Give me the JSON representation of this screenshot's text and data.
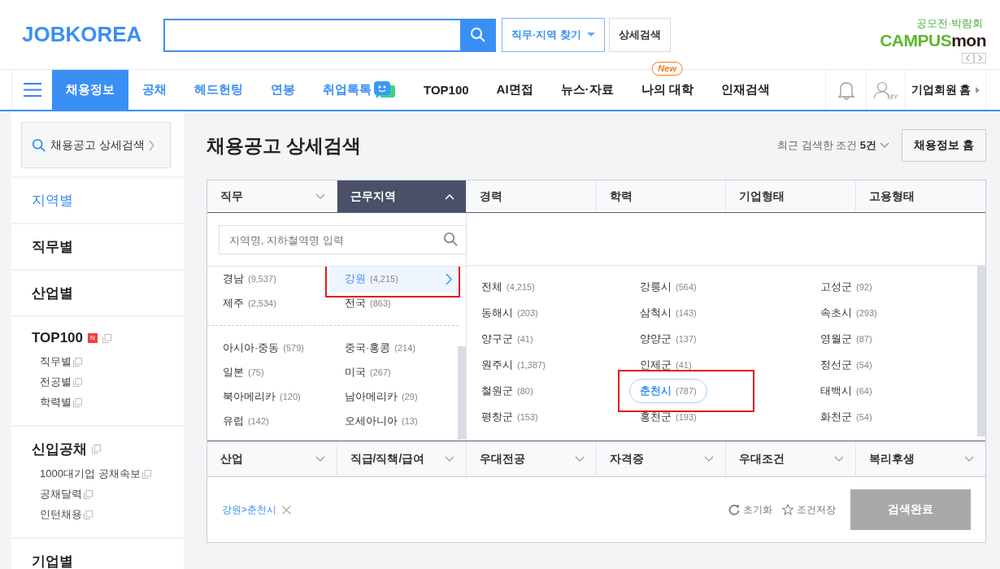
{
  "header": {
    "logo": "JOBKOREA",
    "buttons": [
      {
        "label": "직무·지역 찾기",
        "kind": "dropdown"
      },
      {
        "label": "상세검색",
        "kind": "plain"
      }
    ],
    "ad": {
      "caption": "공모전·박람회",
      "brand_a": "CAMPUS",
      "brand_b": "mon"
    }
  },
  "nav": {
    "items": [
      {
        "label": "채용정보",
        "kind": "featured",
        "selected": true
      },
      {
        "label": "공채",
        "kind": "featured",
        "selected": false
      },
      {
        "label": "헤드헌팅",
        "kind": "featured",
        "selected": false
      },
      {
        "label": "연봉",
        "kind": "featured",
        "selected": false
      },
      {
        "label": "취업톡톡",
        "kind": "featured",
        "selected": false,
        "chat_icon": true
      },
      {
        "label": "TOP100",
        "kind": "plain",
        "selected": false
      },
      {
        "label": "AI면접",
        "kind": "plain",
        "selected": false
      },
      {
        "label": "뉴스·자료",
        "kind": "plain",
        "selected": false
      },
      {
        "label": "나의 대학",
        "kind": "plain",
        "selected": false,
        "badge": "New"
      },
      {
        "label": "인재검색",
        "kind": "plain",
        "selected": false
      }
    ],
    "my_label": "MY",
    "corporate": "기업회원 홈"
  },
  "sidebar": {
    "search_button": "채용공고 상세검색",
    "items": [
      {
        "label": "지역별",
        "selected": true
      },
      {
        "label": "직무별",
        "selected": false
      },
      {
        "label": "산업별",
        "selected": false
      },
      {
        "label": "TOP100",
        "selected": false,
        "badge": "N",
        "children": [
          {
            "label": "직무별"
          },
          {
            "label": "전공별"
          },
          {
            "label": "학력별"
          }
        ]
      },
      {
        "label": "신입공채",
        "selected": false,
        "children": [
          {
            "label": "1000대기업 공채속보"
          },
          {
            "label": "공채달력"
          },
          {
            "label": "인턴채용"
          }
        ]
      },
      {
        "label": "기업별",
        "selected": false
      }
    ]
  },
  "main": {
    "title": "채용공고 상세검색",
    "recent": "최근 검색한 조건 **5건**",
    "home_button": "채용정보 홈",
    "filter_tabs": [
      {
        "label": "직무",
        "selected": false,
        "chevron": true
      },
      {
        "label": "근무지역",
        "selected": true,
        "chevron": true
      },
      {
        "label": "경력",
        "selected": false,
        "chevron": false
      },
      {
        "label": "학력",
        "selected": false,
        "chevron": false
      },
      {
        "label": "기업형태",
        "selected": false,
        "chevron": false
      },
      {
        "label": "고용형태",
        "selected": false,
        "chevron": false
      }
    ],
    "region_search": {
      "placeholder": "지역명, 지하철역명 입력"
    },
    "region_groups": [
      {
        "items": [
          {
            "name": "경남",
            "count": "(9,537)",
            "selected": false,
            "highlighted": false
          },
          {
            "name": "강원",
            "count": "(4,215)",
            "selected": true,
            "highlighted": true
          },
          {
            "name": "제주",
            "count": "(2,534)",
            "selected": false,
            "highlighted": false
          },
          {
            "name": "전국",
            "count": "(863)",
            "selected": false,
            "highlighted": false
          }
        ]
      },
      {
        "items": [
          {
            "name": "아시아·중동",
            "count": "(579)",
            "selected": false,
            "highlighted": false
          },
          {
            "name": "중국·홍콩",
            "count": "(214)",
            "selected": false,
            "highlighted": false
          },
          {
            "name": "일본",
            "count": "(75)",
            "selected": false,
            "highlighted": false
          },
          {
            "name": "미국",
            "count": "(267)",
            "selected": false,
            "highlighted": false
          },
          {
            "name": "북아메리카",
            "count": "(120)",
            "selected": false,
            "highlighted": false
          },
          {
            "name": "남아메리카",
            "count": "(29)",
            "selected": false,
            "highlighted": false
          },
          {
            "name": "유럽",
            "count": "(142)",
            "selected": false,
            "highlighted": false
          },
          {
            "name": "오세아니아",
            "count": "(13)",
            "selected": false,
            "highlighted": false
          }
        ]
      }
    ],
    "cities": [
      {
        "name": "전체",
        "count": "(4,215)",
        "selected": false,
        "highlighted": false
      },
      {
        "name": "강릉시",
        "count": "(564)",
        "selected": false,
        "highlighted": false
      },
      {
        "name": "고성군",
        "count": "(92)",
        "selected": false,
        "highlighted": false
      },
      {
        "name": "동해시",
        "count": "(203)",
        "selected": false,
        "highlighted": false
      },
      {
        "name": "삼척시",
        "count": "(143)",
        "selected": false,
        "highlighted": false
      },
      {
        "name": "속초시",
        "count": "(293)",
        "selected": false,
        "highlighted": false
      },
      {
        "name": "양구군",
        "count": "(41)",
        "selected": false,
        "highlighted": false
      },
      {
        "name": "양양군",
        "count": "(137)",
        "selected": false,
        "highlighted": false
      },
      {
        "name": "영월군",
        "count": "(87)",
        "selected": false,
        "highlighted": false
      },
      {
        "name": "원주시",
        "count": "(1,387)",
        "selected": false,
        "highlighted": false
      },
      {
        "name": "인제군",
        "count": "(41)",
        "selected": false,
        "highlighted": false
      },
      {
        "name": "정선군",
        "count": "(54)",
        "selected": false,
        "highlighted": false
      },
      {
        "name": "철원군",
        "count": "(80)",
        "selected": false,
        "highlighted": false
      },
      {
        "name": "춘천시",
        "count": "(787)",
        "selected": true,
        "highlighted": true
      },
      {
        "name": "태백시",
        "count": "(64)",
        "selected": false,
        "highlighted": false
      },
      {
        "name": "평창군",
        "count": "(153)",
        "selected": false,
        "highlighted": false
      },
      {
        "name": "홍천군",
        "count": "(193)",
        "selected": false,
        "highlighted": false
      },
      {
        "name": "화천군",
        "count": "(54)",
        "selected": false,
        "highlighted": false
      }
    ],
    "filter_tabs_2": [
      {
        "label": "산업"
      },
      {
        "label": "직급/직책/급여"
      },
      {
        "label": "우대전공"
      },
      {
        "label": "자격증"
      },
      {
        "label": "우대조건"
      },
      {
        "label": "복리후생"
      }
    ],
    "selected_tags": [
      {
        "label": "강원>춘천시"
      }
    ],
    "actions": [
      {
        "label": "초기화",
        "kind": "reset"
      },
      {
        "label": "조건저장",
        "kind": "save"
      }
    ],
    "submit": {
      "label": "검색완료",
      "disabled": true
    }
  }
}
